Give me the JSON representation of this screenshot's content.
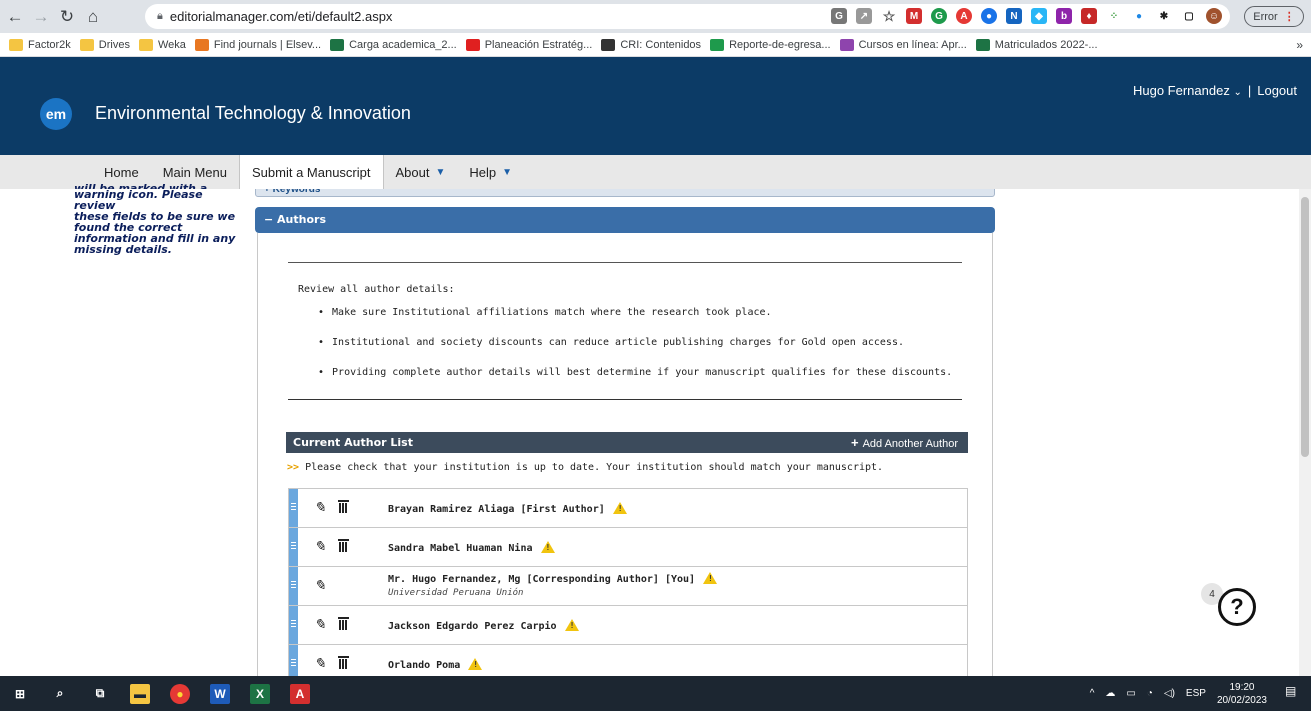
{
  "browser": {
    "url": "editorialmanager.com/eti/default2.aspx",
    "error_label": "Error"
  },
  "bookmarks": [
    {
      "label": "Factor2k",
      "color": "#f4c542"
    },
    {
      "label": "Drives",
      "color": "#f4c542"
    },
    {
      "label": "Weka",
      "color": "#f4c542"
    },
    {
      "label": "Find journals | Elsev...",
      "color": "#e87722"
    },
    {
      "label": "Carga academica_2...",
      "color": "#1d7344"
    },
    {
      "label": "Planeación Estratég...",
      "color": "#e02020"
    },
    {
      "label": "CRI: Contenidos",
      "color": "#333333"
    },
    {
      "label": "Reporte-de-egresa...",
      "color": "#1e9a4c"
    },
    {
      "label": "Cursos en línea: Apr...",
      "color": "#8e44ad"
    },
    {
      "label": "Matriculados 2022-...",
      "color": "#1d7344"
    }
  ],
  "header": {
    "logo_text": "em",
    "journal_title": "Environmental Technology & Innovation",
    "user_name": "Hugo Fernandez",
    "separator": "|",
    "logout": "Logout"
  },
  "menu": {
    "items": [
      "Home",
      "Main Menu",
      "Submit a Manuscript",
      "About",
      "Help"
    ],
    "active": "Submit a Manuscript"
  },
  "left_help": {
    "clipped": "will be marked with a",
    "lines": [
      "warning icon. Please review",
      "these fields to be sure we",
      "found the correct",
      "information and fill in any",
      "missing details."
    ]
  },
  "sections": {
    "keywords": "+ Keywords",
    "authors": "− Authors"
  },
  "review": {
    "intro": "Review all author details:",
    "bullets": [
      "Make sure Institutional affiliations match where the research took place.",
      "Institutional and society discounts can reduce article publishing charges for Gold open access.",
      "Providing complete author details will best determine if your manuscript qualifies for these discounts."
    ]
  },
  "author_list": {
    "title": "Current Author List",
    "add_label": "Add Another Author",
    "note_arrow": ">>",
    "note": "Please check that your institution is up to date. Your institution should match your manuscript.",
    "authors": [
      {
        "name": "Brayan Ramirez Aliaga [First Author]",
        "affiliation": "",
        "deletable": true
      },
      {
        "name": "Sandra Mabel Huaman Nina",
        "affiliation": "",
        "deletable": true
      },
      {
        "name": "Mr. Hugo Fernandez, Mg [Corresponding Author] [You]",
        "affiliation": "Universidad Peruana Unión",
        "deletable": false
      },
      {
        "name": "Jackson Edgardo Perez Carpio",
        "affiliation": "",
        "deletable": true
      },
      {
        "name": "Orlando Poma",
        "affiliation": "",
        "deletable": true
      }
    ]
  },
  "help": {
    "badge": "4",
    "symbol": "?"
  },
  "taskbar": {
    "lang": "ESP",
    "time": "19:20",
    "date": "20/02/2023"
  }
}
